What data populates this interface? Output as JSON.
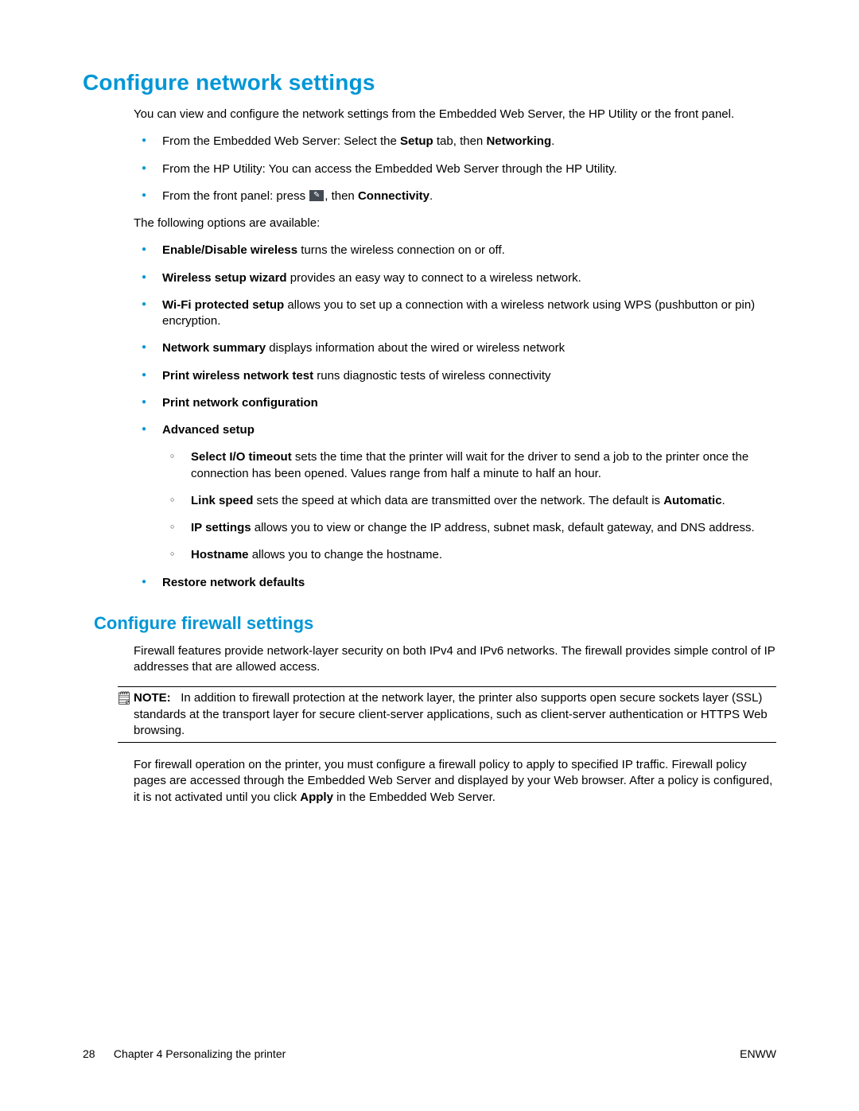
{
  "h1": "Configure network settings",
  "intro": "You can view and configure the network settings from the Embedded Web Server, the HP Utility or the front panel.",
  "access_list": {
    "item1": {
      "pre": "From the Embedded Web Server: Select the ",
      "b1": "Setup",
      "mid": " tab, then ",
      "b2": "Networking",
      "post": "."
    },
    "item2": "From the HP Utility: You can access the Embedded Web Server through the HP Utility.",
    "item3": {
      "pre": "From the front panel: press ",
      "post1": ", then ",
      "b1": "Connectivity",
      "post2": "."
    }
  },
  "avail_label": "The following options are available:",
  "options": {
    "o1": {
      "b": "Enable/Disable wireless",
      "rest": " turns the wireless connection on or off."
    },
    "o2": {
      "b": "Wireless setup wizard",
      "rest": " provides an easy way to connect to a wireless network."
    },
    "o3": {
      "b": "Wi-Fi protected setup",
      "rest": " allows you to set up a connection with a wireless network using WPS (pushbutton or pin) encryption."
    },
    "o4": {
      "b": "Network summary",
      "rest": " displays information about the wired or wireless network"
    },
    "o5": {
      "b": "Print wireless network test",
      "rest": " runs diagnostic tests of wireless connectivity"
    },
    "o6": {
      "b": "Print network configuration"
    },
    "o7": {
      "b": "Advanced setup"
    },
    "adv": {
      "a1": {
        "b": "Select I/O timeout",
        "rest": " sets the time that the printer will wait for the driver to send a job to the printer once the connection has been opened. Values range from half a minute to half an hour."
      },
      "a2": {
        "b": "Link speed",
        "rest": " sets the speed at which data are transmitted over the network. The default is ",
        "b2": "Automatic",
        "post": "."
      },
      "a3": {
        "b": "IP settings",
        "rest": " allows you to view or change the IP address, subnet mask, default gateway, and DNS address."
      },
      "a4": {
        "b": "Hostname",
        "rest": " allows you to change the hostname."
      }
    },
    "o8": {
      "b": "Restore network defaults"
    }
  },
  "h2": "Configure firewall settings",
  "fw_intro": "Firewall features provide network-layer security on both IPv4 and IPv6 networks. The firewall provides simple control of IP addresses that are allowed access.",
  "note_label": "NOTE:",
  "note_body": "In addition to firewall protection at the network layer, the printer also supports open secure sockets layer (SSL) standards at the transport layer for secure client-server applications, such as client-server authentication or HTTPS Web browsing.",
  "fw_operation_pre": "For firewall operation on the printer, you must configure a firewall policy to apply to specified IP traffic. Firewall policy pages are accessed through the Embedded Web Server and displayed by your Web browser. After a policy is configured, it is not activated until you click ",
  "fw_apply": "Apply",
  "fw_operation_post": " in the Embedded Web Server.",
  "footer": {
    "page": "28",
    "chapter": "Chapter 4   Personalizing the printer",
    "right": "ENWW"
  }
}
